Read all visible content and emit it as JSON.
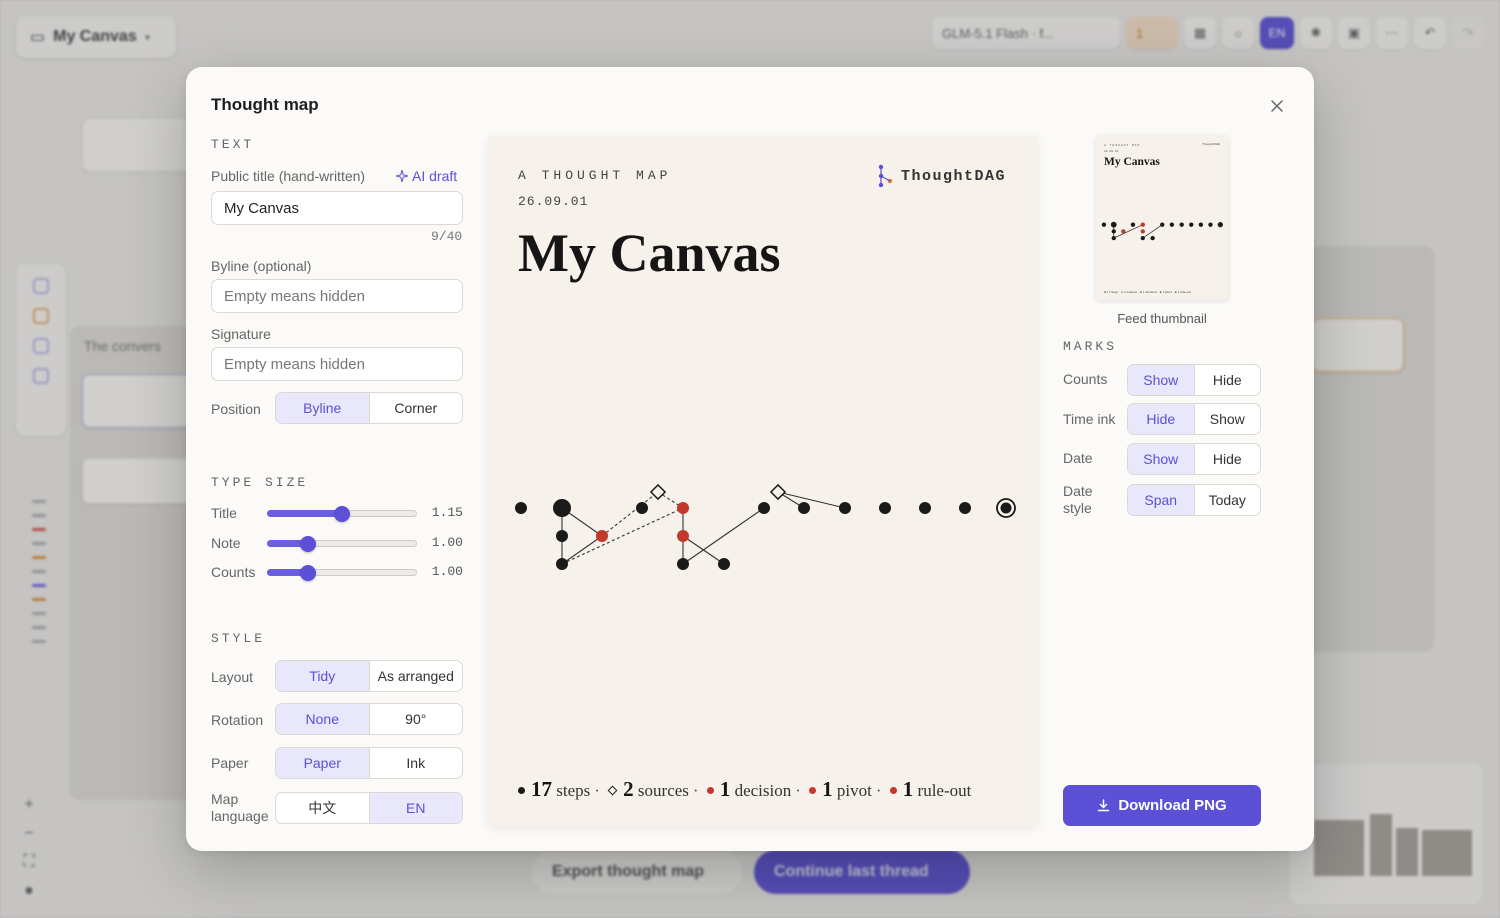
{
  "background": {
    "canvas_title": "My Canvas",
    "model_chip": "GLM-5.1 Flash · f...",
    "warning_count": "1",
    "language_chip": "EN",
    "conversation_label": "The convers",
    "export_button": "Export thought map",
    "continue_button": "Continue last thread"
  },
  "modal": {
    "title": "Thought map",
    "text_section": "TEXT",
    "public_title_label": "Public title (hand-written)",
    "ai_draft": "AI draft",
    "public_title_value": "My Canvas",
    "title_counter": "9/40",
    "byline_label": "Byline (optional)",
    "byline_placeholder": "Empty means hidden",
    "signature_label": "Signature",
    "signature_placeholder": "Empty means hidden",
    "position_label": "Position",
    "position_options": [
      "Byline",
      "Corner"
    ],
    "position_selected": "Byline",
    "type_size_section": "TYPE SIZE",
    "sliders": [
      {
        "label": "Title",
        "value": "1.15",
        "level": 0.5
      },
      {
        "label": "Note",
        "value": "1.00",
        "level": 0.27
      },
      {
        "label": "Counts",
        "value": "1.00",
        "level": 0.27
      }
    ],
    "style_section": "STYLE",
    "layout_label": "Layout",
    "layout_options": [
      "Tidy",
      "As arranged"
    ],
    "rotation_label": "Rotation",
    "rotation_options": [
      "None",
      "90°"
    ],
    "paper_label": "Paper",
    "paper_options": [
      "Paper",
      "Ink"
    ],
    "map_language_label": "Map language",
    "map_language_options": [
      "中文",
      "EN"
    ],
    "thumbnail_caption": "Feed thumbnail",
    "marks_section": "MARKS",
    "counts_label": "Counts",
    "counts_options": [
      "Show",
      "Hide"
    ],
    "time_ink_label": "Time ink",
    "time_ink_options": [
      "Hide",
      "Show"
    ],
    "date_label": "Date",
    "date_options": [
      "Show",
      "Hide"
    ],
    "date_style_label": "Date style",
    "date_style_options": [
      "Span",
      "Today"
    ],
    "download_button": "Download PNG"
  },
  "poster": {
    "kicker": "A THOUGHT MAP",
    "date": "26.09.01",
    "title": "My Canvas",
    "brand": "ThoughtDAG",
    "stats": {
      "steps_n": "17",
      "steps": "steps",
      "sources_n": "2",
      "sources": "sources",
      "decision_n": "1",
      "decision": "decision",
      "pivot_n": "1",
      "pivot": "pivot",
      "ruleout_n": "1",
      "ruleout": "rule-out"
    }
  },
  "colors": {
    "accent": "#5b50d6",
    "accent_soft": "#e9e7fb",
    "node_ink": "#1a1a1a",
    "node_red": "#c0392b",
    "paper": "#f6f2eb"
  }
}
